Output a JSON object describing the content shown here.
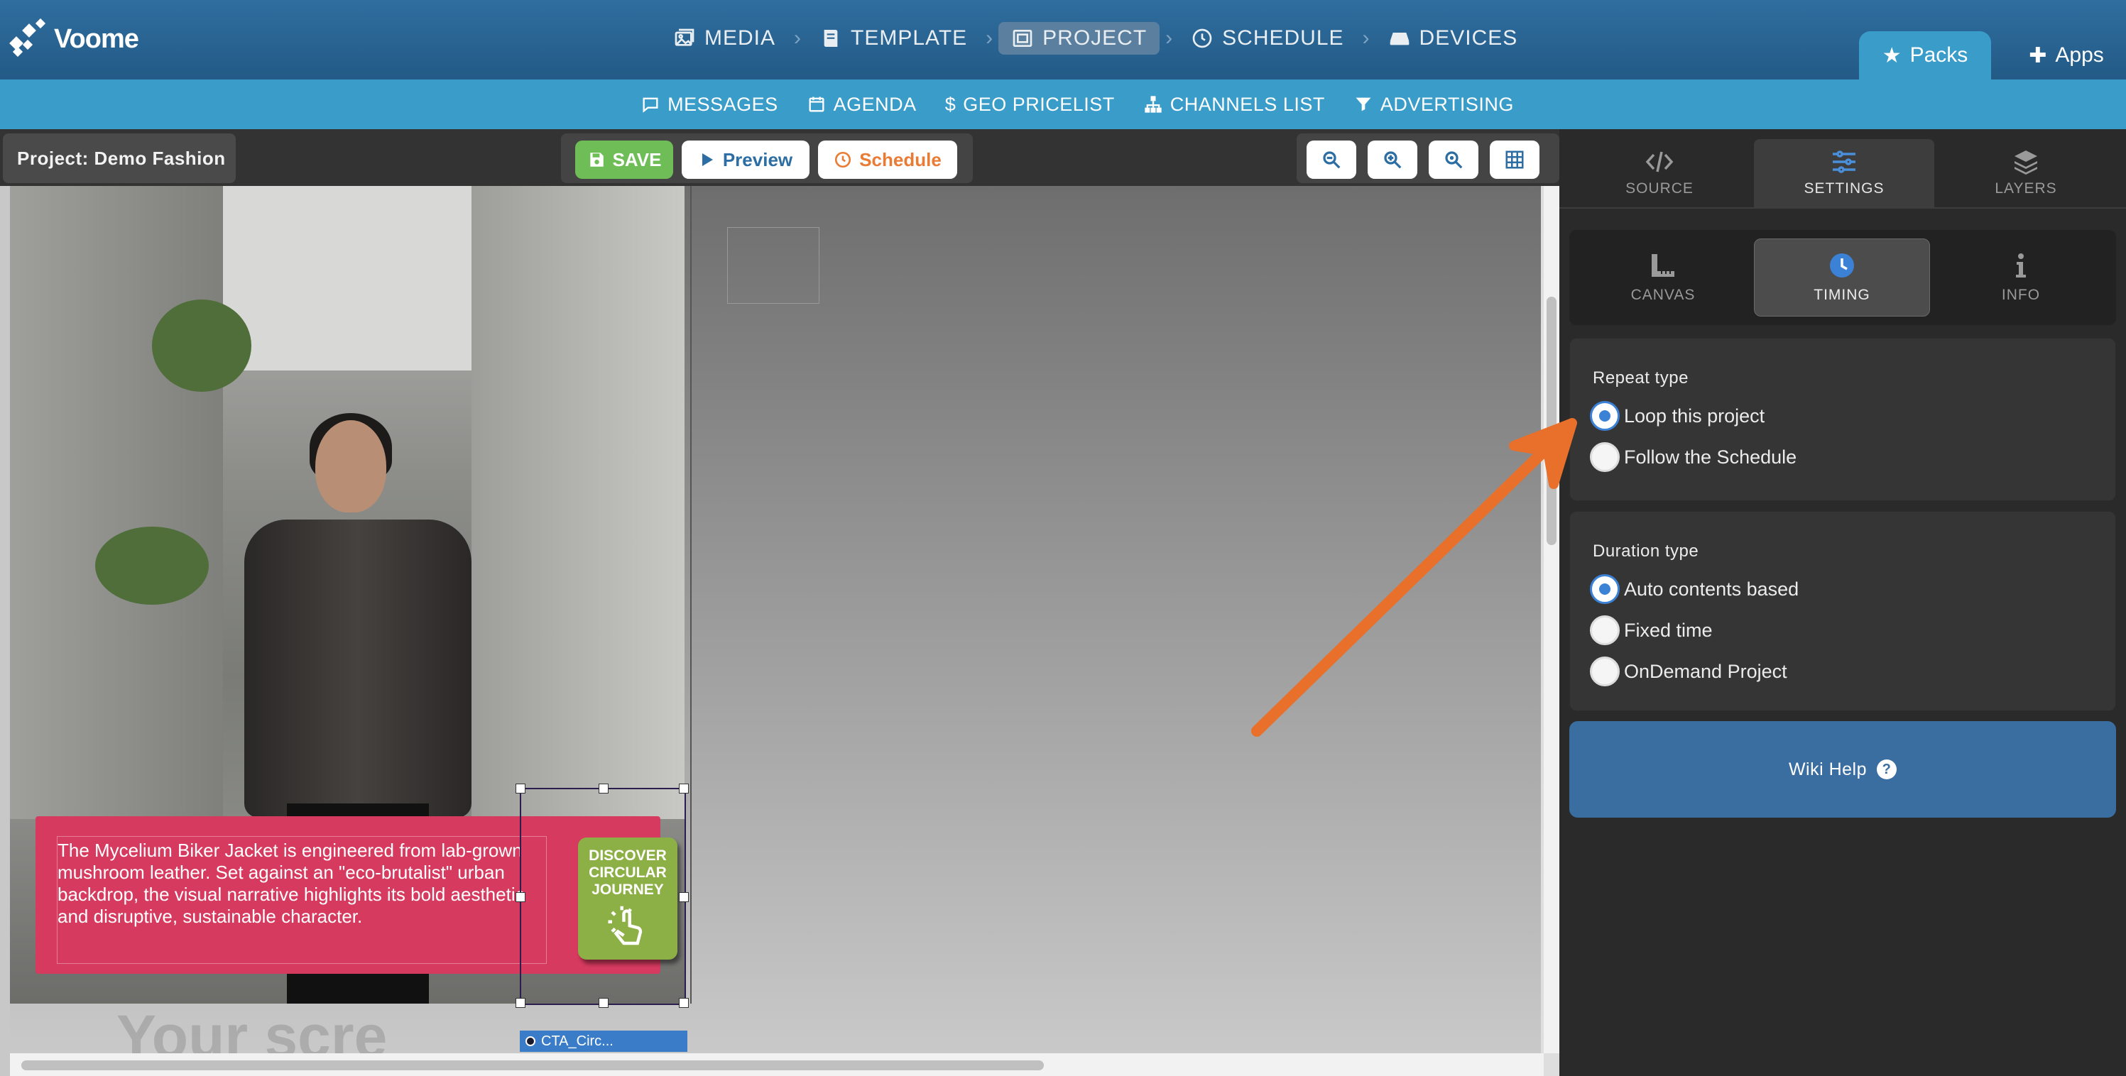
{
  "app": {
    "logo_text": "Voome"
  },
  "main_nav": [
    {
      "label": "MEDIA",
      "icon": "media-icon",
      "active": false
    },
    {
      "label": "TEMPLATE",
      "icon": "template-icon",
      "active": false
    },
    {
      "label": "PROJECT",
      "icon": "project-icon",
      "active": true
    },
    {
      "label": "SCHEDULE",
      "icon": "clock-icon",
      "active": false
    },
    {
      "label": "DEVICES",
      "icon": "devices-icon",
      "active": false
    }
  ],
  "top_tabs": {
    "packs": "Packs",
    "apps": "Apps"
  },
  "sub_nav": [
    {
      "label": "MESSAGES",
      "icon": "message-icon"
    },
    {
      "label": "AGENDA",
      "icon": "calendar-icon"
    },
    {
      "label": "GEO PRICELIST",
      "icon": "dollar-icon"
    },
    {
      "label": "CHANNELS LIST",
      "icon": "sitemap-icon"
    },
    {
      "label": "ADVERTISING",
      "icon": "filter-icon"
    }
  ],
  "toolbar": {
    "project_label": "Project: Demo Fashion",
    "save": "SAVE",
    "preview": "Preview",
    "schedule": "Schedule"
  },
  "canvas": {
    "cta_text": "The Mycelium Biker Jacket is engineered from lab-grown mushroom leather. Set against an \"eco-brutalist\" urban backdrop, the visual narrative highlights its bold aesthetic and disruptive, sustainable character.",
    "cta_button_line1": "DISCOVER",
    "cta_button_line2": "CIRCULAR",
    "cta_button_line3": "JOURNEY",
    "selected_layer_label": "CTA_Circ...",
    "watermark": "Your scre"
  },
  "panel": {
    "tabs": [
      "SOURCE",
      "SETTINGS",
      "LAYERS"
    ],
    "active_tab": "SETTINGS",
    "subtabs": [
      "CANVAS",
      "TIMING",
      "INFO"
    ],
    "active_subtab": "TIMING",
    "repeat_type": {
      "title": "Repeat type",
      "options": [
        "Loop this project",
        "Follow the Schedule"
      ],
      "selected": "Loop this project"
    },
    "duration_type": {
      "title": "Duration type",
      "options": [
        "Auto contents based",
        "Fixed time",
        "OnDemand Project"
      ],
      "selected": "Auto contents based"
    },
    "wiki_help": "Wiki Help"
  },
  "colors": {
    "accent": "#3a9cc8",
    "annotation_arrow": "#e8702a",
    "save_green": "#6ebd57",
    "schedule_orange": "#e97b34",
    "cta_pink": "#d63a5f",
    "cta_green": "#8db046"
  }
}
